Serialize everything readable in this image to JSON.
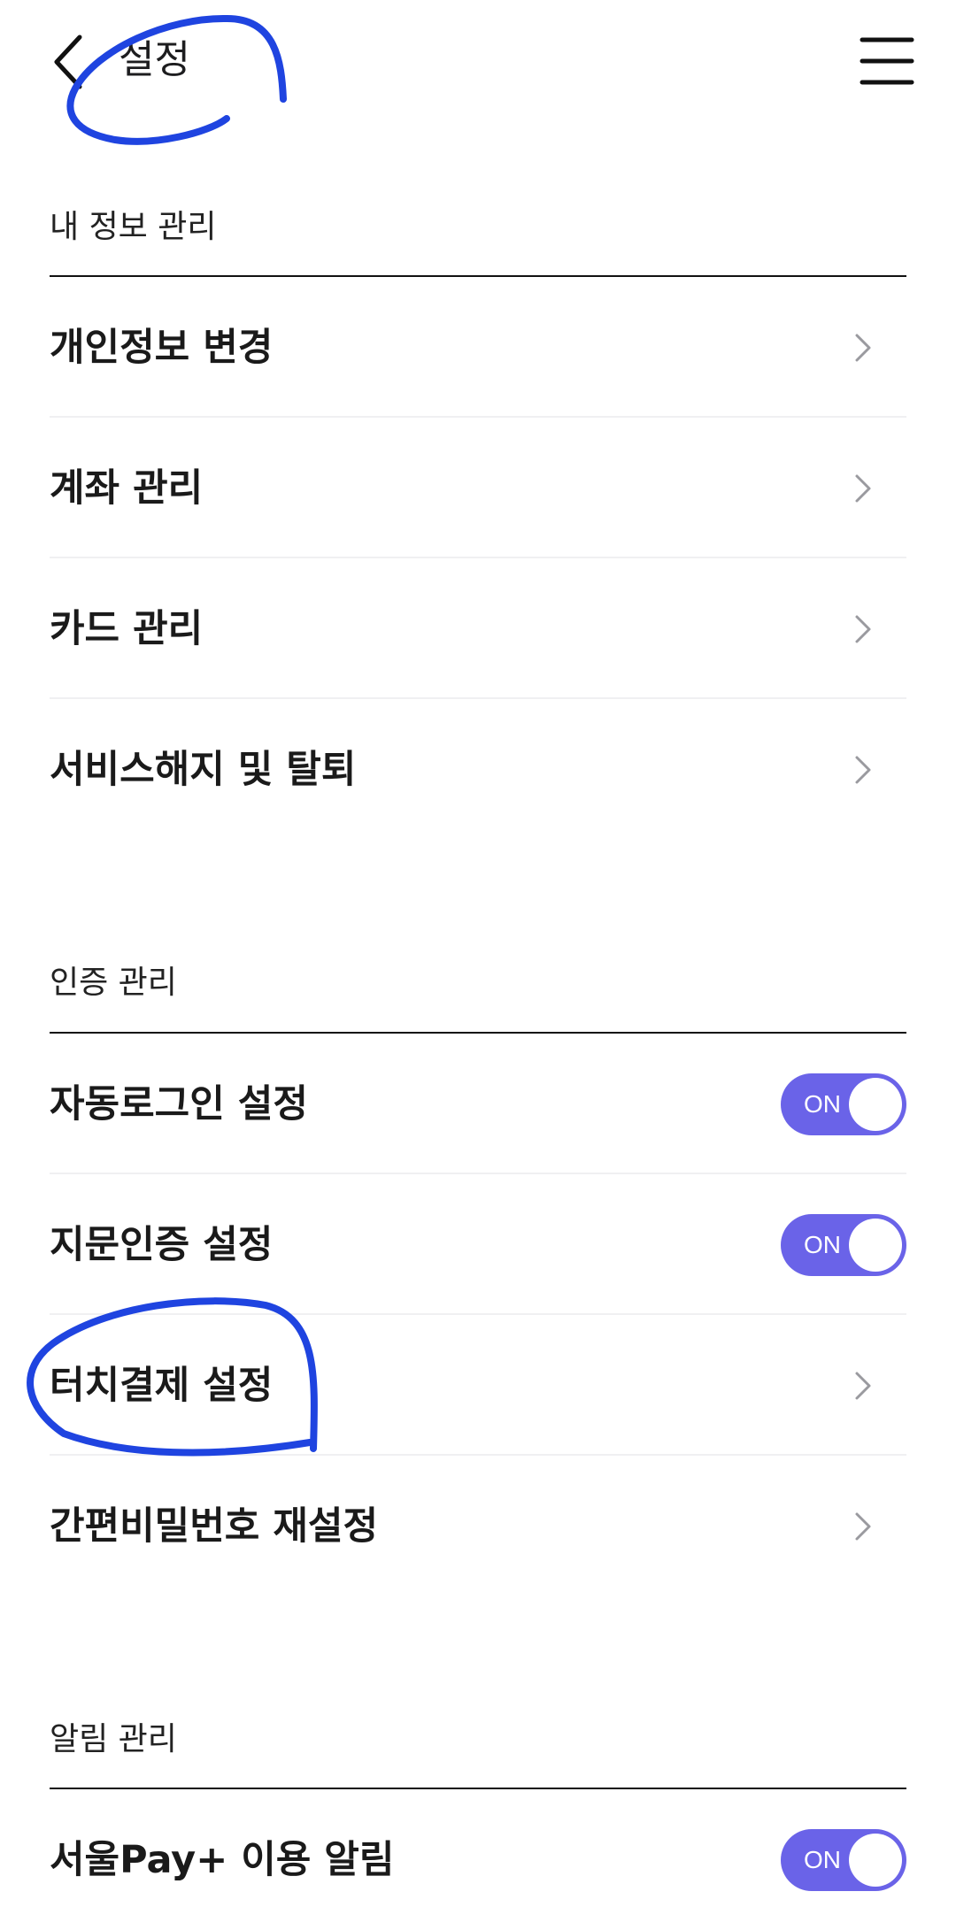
{
  "header": {
    "title": "설정"
  },
  "sections": [
    {
      "title": "내 정보 관리",
      "items": [
        {
          "label": "개인정보 변경"
        },
        {
          "label": "계좌 관리"
        },
        {
          "label": "카드 관리"
        },
        {
          "label": "서비스해지 및 탈퇴"
        }
      ]
    },
    {
      "title": "인증 관리",
      "items": [
        {
          "label": "자동로그인 설정",
          "toggle": "ON"
        },
        {
          "label": "지문인증 설정",
          "toggle": "ON"
        },
        {
          "label": "터치결제 설정"
        },
        {
          "label": "간편비밀번호 재설정"
        }
      ]
    },
    {
      "title": "알림 관리",
      "items": [
        {
          "label": "서울Pay+ 이용 알림",
          "toggle": "ON"
        }
      ]
    }
  ],
  "colors": {
    "toggle_on": "#6a63e8",
    "annotation": "#1f44e0",
    "divider": "#f0f0f2"
  },
  "icons": {
    "back": "chevron-left-icon",
    "menu": "hamburger-menu-icon",
    "row": "chevron-right-icon"
  }
}
